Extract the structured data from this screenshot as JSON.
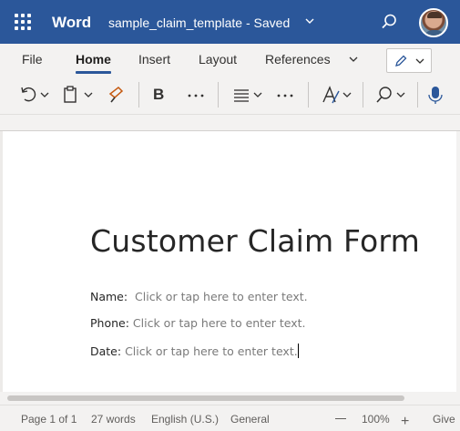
{
  "titlebar": {
    "app_name": "Word",
    "doc_title": "sample_claim_template",
    "separator": "-",
    "save_status": "Saved",
    "brand_color": "#2b579a",
    "icons": [
      "app-launcher-icon",
      "chevron-down-icon",
      "search-icon",
      "avatar"
    ]
  },
  "ribbon": {
    "tabs": [
      {
        "label": "File"
      },
      {
        "label": "Home",
        "active": true
      },
      {
        "label": "Insert"
      },
      {
        "label": "Layout"
      },
      {
        "label": "References"
      }
    ],
    "tools": [
      "undo-icon",
      "paste-icon",
      "format-painter-icon",
      "bold-icon",
      "more-icon",
      "align-icon",
      "more-icon",
      "styles-icon",
      "find-icon",
      "dictate-icon"
    ],
    "bold_label": "B"
  },
  "document": {
    "heading": "Customer Claim Form",
    "fields": [
      {
        "label": "Name:",
        "placeholder": "Click or tap here to enter text."
      },
      {
        "label": "Phone:",
        "placeholder": "Click or tap here to enter text."
      },
      {
        "label": "Date:",
        "placeholder": "Click or tap here to enter text."
      }
    ]
  },
  "statusbar": {
    "page": "Page 1 of 1",
    "words": "27 words",
    "language": "English (U.S.)",
    "category": "General",
    "zoom": "100%",
    "feedback": "Give"
  }
}
